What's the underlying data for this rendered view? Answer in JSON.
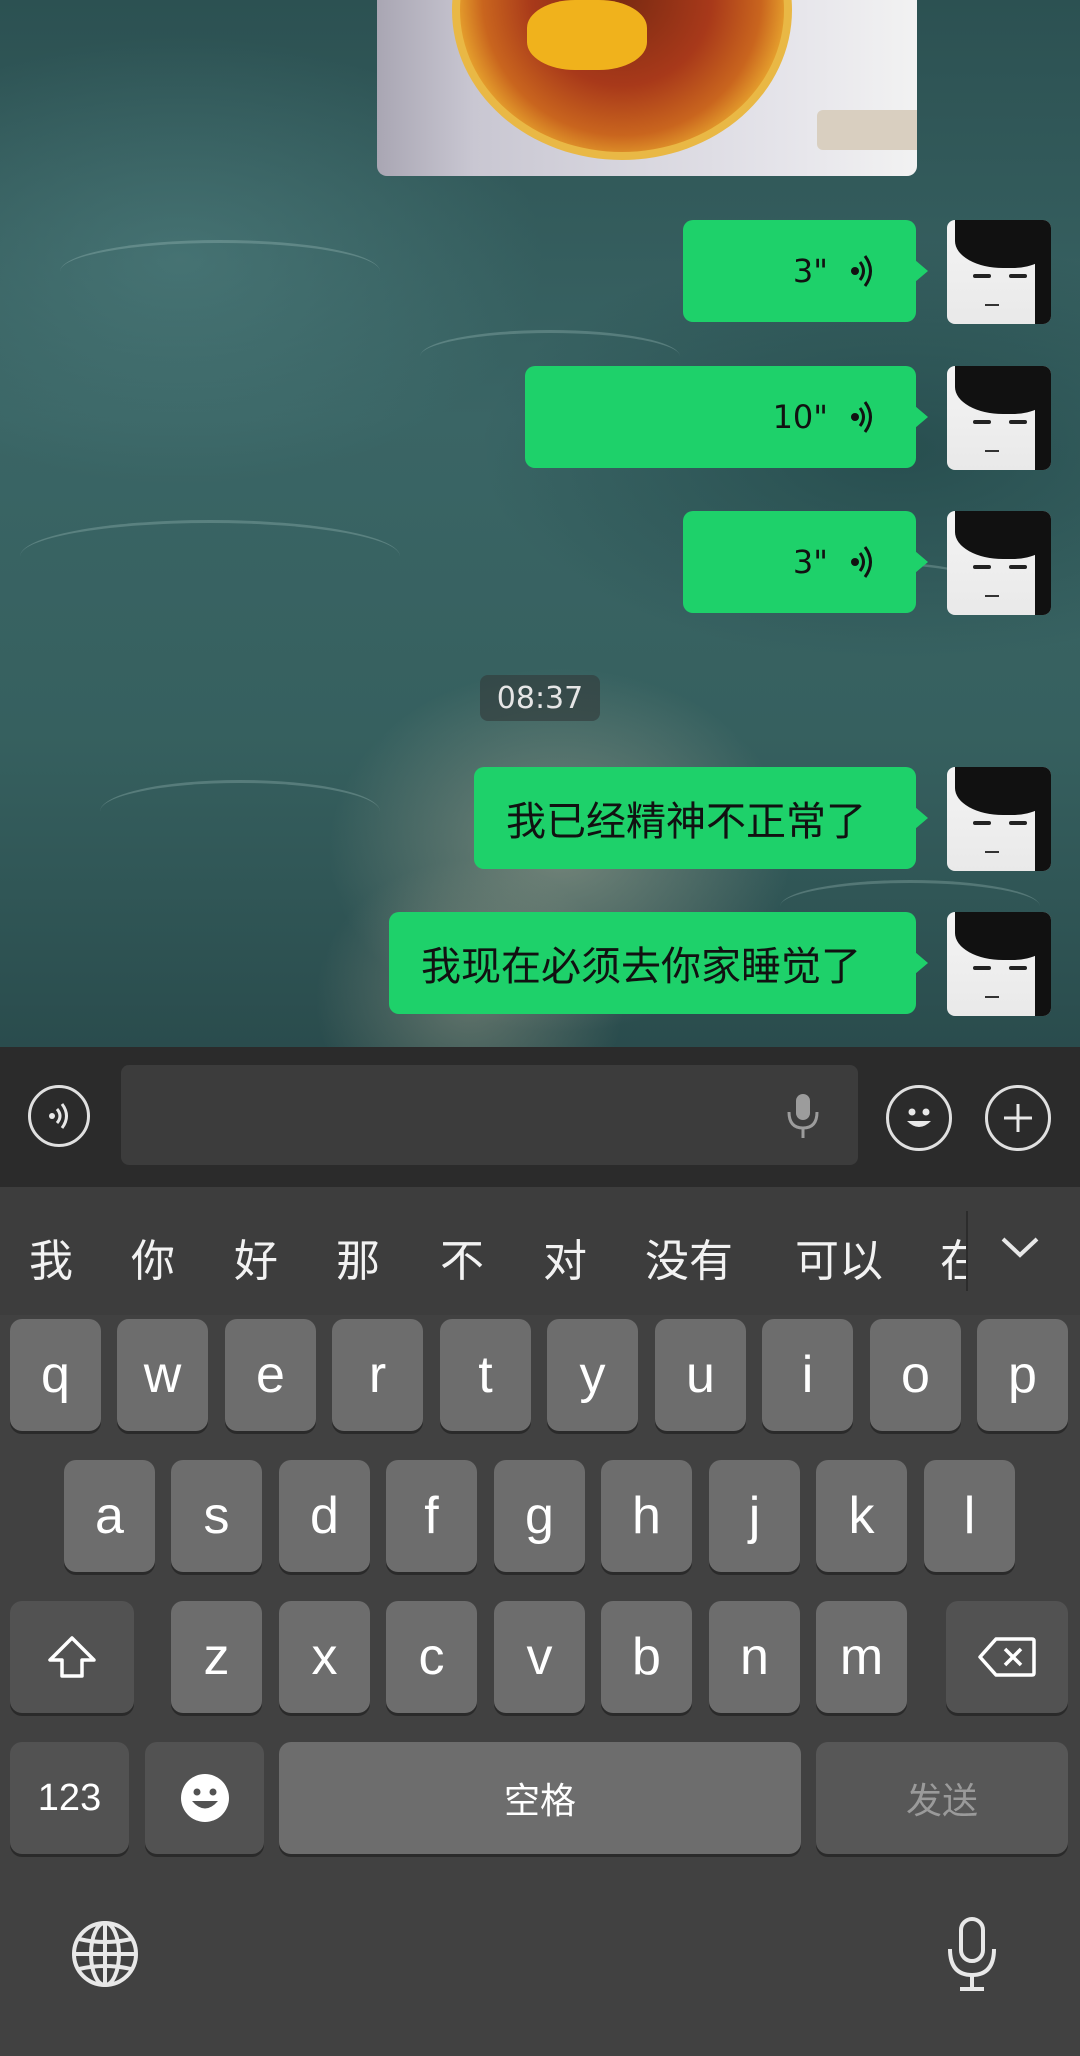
{
  "chat": {
    "messages": [
      {
        "type": "voice",
        "duration": "3\""
      },
      {
        "type": "voice",
        "duration": "10\""
      },
      {
        "type": "voice",
        "duration": "3\""
      },
      {
        "type": "text",
        "text": "我已经精神不正常了"
      },
      {
        "type": "text",
        "text": "我现在必须去你家睡觉了"
      }
    ],
    "timestamp": "08:37",
    "bubble_color": "#1ed16a"
  },
  "input_bar": {
    "voice_toggle_icon": "voice-wave-icon",
    "input_value": "",
    "mic_icon": "microphone-icon",
    "emoji_icon": "smiley-icon",
    "more_icon": "plus-circle-icon"
  },
  "keyboard": {
    "candidates": [
      "我",
      "你",
      "好",
      "那",
      "不",
      "对",
      "没有",
      "可以",
      "在"
    ],
    "collapse_icon": "chevron-down-icon",
    "row1": [
      "q",
      "w",
      "e",
      "r",
      "t",
      "y",
      "u",
      "i",
      "o",
      "p"
    ],
    "row2": [
      "a",
      "s",
      "d",
      "f",
      "g",
      "h",
      "j",
      "k",
      "l"
    ],
    "row3": [
      "z",
      "x",
      "c",
      "v",
      "b",
      "n",
      "m"
    ],
    "shift_icon": "shift-arrow-icon",
    "backspace_icon": "backspace-icon",
    "numbers_label": "123",
    "emoji_key_icon": "emoji-face-icon",
    "space_label": "空格",
    "send_label": "发送",
    "globe_icon": "globe-icon",
    "dictation_icon": "microphone-icon"
  }
}
